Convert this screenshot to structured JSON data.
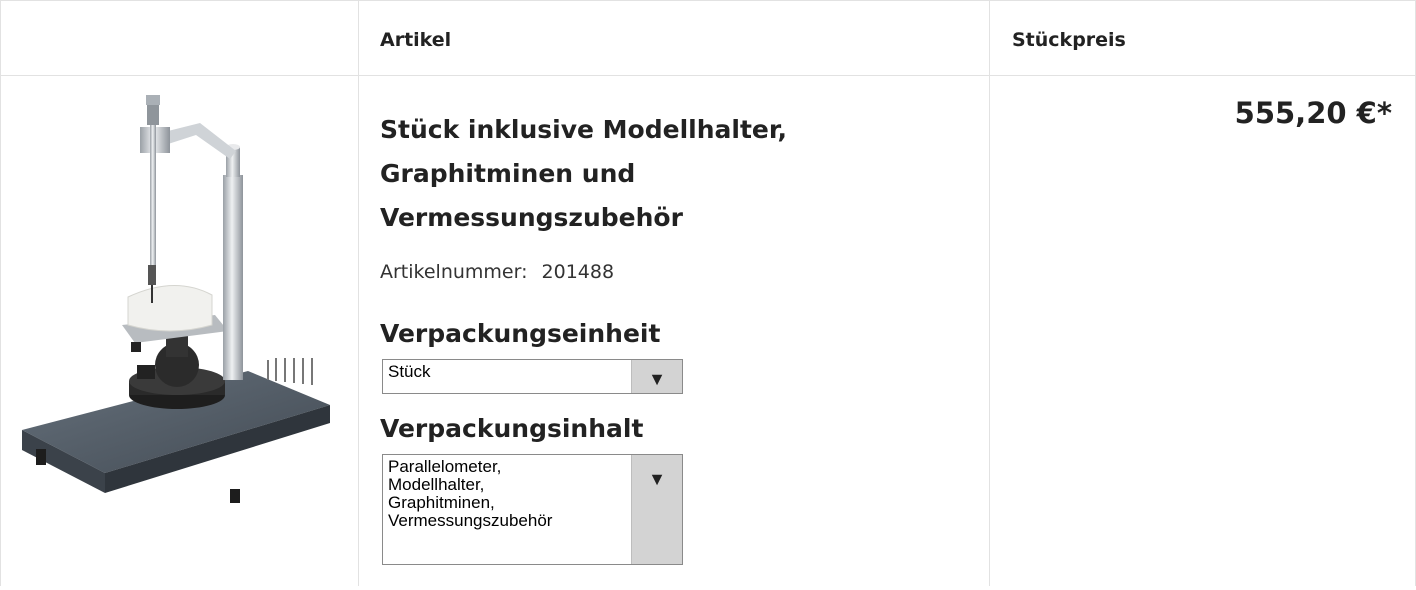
{
  "table": {
    "headers": {
      "image": "",
      "article": "Artikel",
      "price": "Stückpreis"
    }
  },
  "product": {
    "image_alt": "Parallelometer",
    "title_lines": [
      "Stück inklusive Modellhalter,",
      "Graphitminen und",
      "Vermessungszubehör"
    ],
    "article_number_label": "Artikelnummer:",
    "article_number": "201488",
    "packaging_unit_label": "Verpackungseinheit",
    "packaging_unit_value": "Stück",
    "packaging_content_label": "Verpackungsinhalt",
    "packaging_content_lines": [
      "Parallelometer,",
      "Modellhalter,",
      "Graphitminen,",
      "Vermessungszubehör"
    ],
    "price": "555,20 €*"
  },
  "icons": {
    "dropdown": "chevron-down-icon"
  },
  "colors": {
    "border": "#e2e2e2",
    "select_button": "#d3d3d3",
    "base_plate": "#4f5862"
  }
}
